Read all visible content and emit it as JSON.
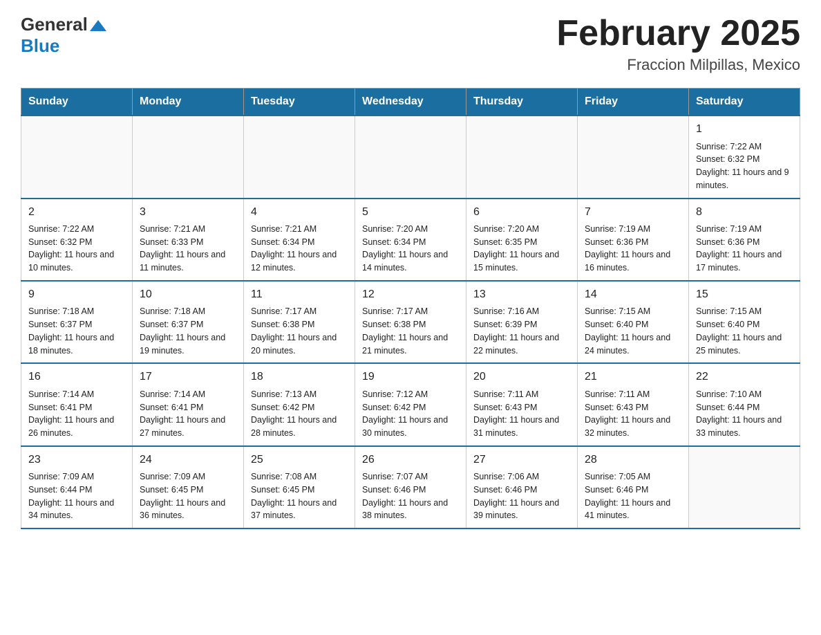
{
  "header": {
    "logo_general": "General",
    "logo_blue": "Blue",
    "title": "February 2025",
    "subtitle": "Fraccion Milpillas, Mexico"
  },
  "weekdays": [
    "Sunday",
    "Monday",
    "Tuesday",
    "Wednesday",
    "Thursday",
    "Friday",
    "Saturday"
  ],
  "weeks": [
    [
      {
        "day": "",
        "sunrise": "",
        "sunset": "",
        "daylight": ""
      },
      {
        "day": "",
        "sunrise": "",
        "sunset": "",
        "daylight": ""
      },
      {
        "day": "",
        "sunrise": "",
        "sunset": "",
        "daylight": ""
      },
      {
        "day": "",
        "sunrise": "",
        "sunset": "",
        "daylight": ""
      },
      {
        "day": "",
        "sunrise": "",
        "sunset": "",
        "daylight": ""
      },
      {
        "day": "",
        "sunrise": "",
        "sunset": "",
        "daylight": ""
      },
      {
        "day": "1",
        "sunrise": "Sunrise: 7:22 AM",
        "sunset": "Sunset: 6:32 PM",
        "daylight": "Daylight: 11 hours and 9 minutes."
      }
    ],
    [
      {
        "day": "2",
        "sunrise": "Sunrise: 7:22 AM",
        "sunset": "Sunset: 6:32 PM",
        "daylight": "Daylight: 11 hours and 10 minutes."
      },
      {
        "day": "3",
        "sunrise": "Sunrise: 7:21 AM",
        "sunset": "Sunset: 6:33 PM",
        "daylight": "Daylight: 11 hours and 11 minutes."
      },
      {
        "day": "4",
        "sunrise": "Sunrise: 7:21 AM",
        "sunset": "Sunset: 6:34 PM",
        "daylight": "Daylight: 11 hours and 12 minutes."
      },
      {
        "day": "5",
        "sunrise": "Sunrise: 7:20 AM",
        "sunset": "Sunset: 6:34 PM",
        "daylight": "Daylight: 11 hours and 14 minutes."
      },
      {
        "day": "6",
        "sunrise": "Sunrise: 7:20 AM",
        "sunset": "Sunset: 6:35 PM",
        "daylight": "Daylight: 11 hours and 15 minutes."
      },
      {
        "day": "7",
        "sunrise": "Sunrise: 7:19 AM",
        "sunset": "Sunset: 6:36 PM",
        "daylight": "Daylight: 11 hours and 16 minutes."
      },
      {
        "day": "8",
        "sunrise": "Sunrise: 7:19 AM",
        "sunset": "Sunset: 6:36 PM",
        "daylight": "Daylight: 11 hours and 17 minutes."
      }
    ],
    [
      {
        "day": "9",
        "sunrise": "Sunrise: 7:18 AM",
        "sunset": "Sunset: 6:37 PM",
        "daylight": "Daylight: 11 hours and 18 minutes."
      },
      {
        "day": "10",
        "sunrise": "Sunrise: 7:18 AM",
        "sunset": "Sunset: 6:37 PM",
        "daylight": "Daylight: 11 hours and 19 minutes."
      },
      {
        "day": "11",
        "sunrise": "Sunrise: 7:17 AM",
        "sunset": "Sunset: 6:38 PM",
        "daylight": "Daylight: 11 hours and 20 minutes."
      },
      {
        "day": "12",
        "sunrise": "Sunrise: 7:17 AM",
        "sunset": "Sunset: 6:38 PM",
        "daylight": "Daylight: 11 hours and 21 minutes."
      },
      {
        "day": "13",
        "sunrise": "Sunrise: 7:16 AM",
        "sunset": "Sunset: 6:39 PM",
        "daylight": "Daylight: 11 hours and 22 minutes."
      },
      {
        "day": "14",
        "sunrise": "Sunrise: 7:15 AM",
        "sunset": "Sunset: 6:40 PM",
        "daylight": "Daylight: 11 hours and 24 minutes."
      },
      {
        "day": "15",
        "sunrise": "Sunrise: 7:15 AM",
        "sunset": "Sunset: 6:40 PM",
        "daylight": "Daylight: 11 hours and 25 minutes."
      }
    ],
    [
      {
        "day": "16",
        "sunrise": "Sunrise: 7:14 AM",
        "sunset": "Sunset: 6:41 PM",
        "daylight": "Daylight: 11 hours and 26 minutes."
      },
      {
        "day": "17",
        "sunrise": "Sunrise: 7:14 AM",
        "sunset": "Sunset: 6:41 PM",
        "daylight": "Daylight: 11 hours and 27 minutes."
      },
      {
        "day": "18",
        "sunrise": "Sunrise: 7:13 AM",
        "sunset": "Sunset: 6:42 PM",
        "daylight": "Daylight: 11 hours and 28 minutes."
      },
      {
        "day": "19",
        "sunrise": "Sunrise: 7:12 AM",
        "sunset": "Sunset: 6:42 PM",
        "daylight": "Daylight: 11 hours and 30 minutes."
      },
      {
        "day": "20",
        "sunrise": "Sunrise: 7:11 AM",
        "sunset": "Sunset: 6:43 PM",
        "daylight": "Daylight: 11 hours and 31 minutes."
      },
      {
        "day": "21",
        "sunrise": "Sunrise: 7:11 AM",
        "sunset": "Sunset: 6:43 PM",
        "daylight": "Daylight: 11 hours and 32 minutes."
      },
      {
        "day": "22",
        "sunrise": "Sunrise: 7:10 AM",
        "sunset": "Sunset: 6:44 PM",
        "daylight": "Daylight: 11 hours and 33 minutes."
      }
    ],
    [
      {
        "day": "23",
        "sunrise": "Sunrise: 7:09 AM",
        "sunset": "Sunset: 6:44 PM",
        "daylight": "Daylight: 11 hours and 34 minutes."
      },
      {
        "day": "24",
        "sunrise": "Sunrise: 7:09 AM",
        "sunset": "Sunset: 6:45 PM",
        "daylight": "Daylight: 11 hours and 36 minutes."
      },
      {
        "day": "25",
        "sunrise": "Sunrise: 7:08 AM",
        "sunset": "Sunset: 6:45 PM",
        "daylight": "Daylight: 11 hours and 37 minutes."
      },
      {
        "day": "26",
        "sunrise": "Sunrise: 7:07 AM",
        "sunset": "Sunset: 6:46 PM",
        "daylight": "Daylight: 11 hours and 38 minutes."
      },
      {
        "day": "27",
        "sunrise": "Sunrise: 7:06 AM",
        "sunset": "Sunset: 6:46 PM",
        "daylight": "Daylight: 11 hours and 39 minutes."
      },
      {
        "day": "28",
        "sunrise": "Sunrise: 7:05 AM",
        "sunset": "Sunset: 6:46 PM",
        "daylight": "Daylight: 11 hours and 41 minutes."
      },
      {
        "day": "",
        "sunrise": "",
        "sunset": "",
        "daylight": ""
      }
    ]
  ]
}
